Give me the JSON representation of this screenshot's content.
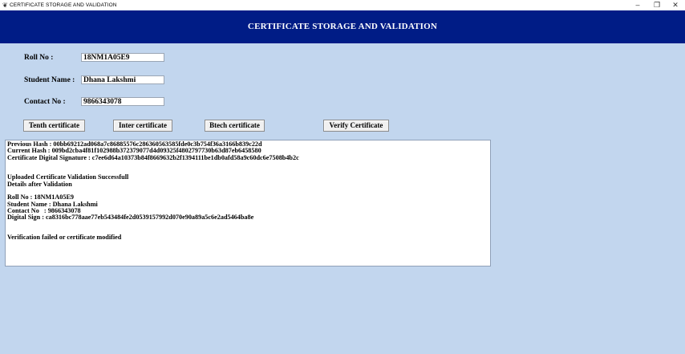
{
  "window": {
    "title": "CERTIFICATE STORAGE AND VALIDATION",
    "minimize": "–",
    "maximize": "❐",
    "close": "✕"
  },
  "header": {
    "title": "CERTIFICATE STORAGE AND VALIDATION"
  },
  "form": {
    "roll_label": "Roll No :",
    "roll_value": "18NM1A05E9",
    "name_label": "Student Name :",
    "name_value": "Dhana Lakshmi",
    "contact_label": "Contact No :",
    "contact_value": "9866343078"
  },
  "buttons": {
    "tenth": "Tenth certificate",
    "inter": "Inter certificate",
    "btech": "Btech certificate",
    "verify": "Verify Certificate"
  },
  "output_lines": [
    "Previous Hash : 00bb69212ad068a7c86885576c286360563585fde0c3b754f36a3166b839c22d",
    "Current Hash : 009bd2cba4f81f102988b372379077d4d09325f4802797730b63d87eb6458580",
    "Certificate Digital Signature : c7ee6d64a10373b84f8669632b2f1394111be1db0afd58a9c60dc6e7508b4b2c",
    "",
    "",
    "Uploaded Certificate Validation Successfull",
    "Details after Validation",
    "",
    "Roll No : 18NM1A05E9",
    "Student Name : Dhana Lakshmi",
    "Contact No   : 9866343078",
    "Digital Sign : ca8316bc778aae77eb543484fe2d0539157992d070e90a89a5c6e2ad5464ba8e",
    "",
    "",
    "Verification failed or certificate modified"
  ]
}
